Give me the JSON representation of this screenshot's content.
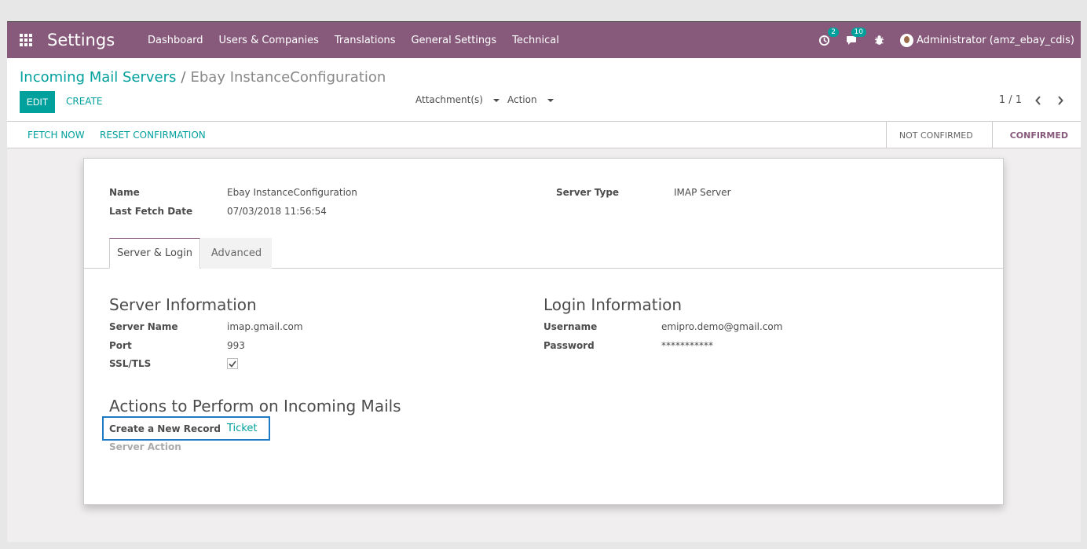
{
  "topbar": {
    "brand": "Settings",
    "menu": [
      "Dashboard",
      "Users & Companies",
      "Translations",
      "General Settings",
      "Technical"
    ],
    "activity_badge": "2",
    "messages_badge": "10",
    "user": "Administrator (amz_ebay_cdis)"
  },
  "control_panel": {
    "breadcrumb_parent": "Incoming Mail Servers",
    "breadcrumb_sep": "/",
    "breadcrumb_current": "Ebay InstanceConfiguration",
    "edit": "EDIT",
    "create": "CREATE",
    "attachments": "Attachment(s)",
    "action": "Action",
    "pager": "1 / 1"
  },
  "statusbar": {
    "fetch_now": "FETCH NOW",
    "reset_confirmation": "RESET CONFIRMATION",
    "states": [
      "NOT CONFIRMED",
      "CONFIRMED"
    ],
    "current_state": "CONFIRMED"
  },
  "form": {
    "name_label": "Name",
    "name_value": "Ebay InstanceConfiguration",
    "last_fetch_label": "Last Fetch Date",
    "last_fetch_value": "07/03/2018 11:56:54",
    "server_type_label": "Server Type",
    "server_type_value": "IMAP Server",
    "tabs": [
      "Server & Login",
      "Advanced"
    ],
    "server_info_title": "Server Information",
    "server_name_label": "Server Name",
    "server_name_value": "imap.gmail.com",
    "port_label": "Port",
    "port_value": "993",
    "ssl_label": "SSL/TLS",
    "ssl_checked": true,
    "login_info_title": "Login Information",
    "username_label": "Username",
    "username_value": "emipro.demo@gmail.com",
    "password_label": "Password",
    "password_value": "***********",
    "actions_title": "Actions to Perform on Incoming Mails",
    "create_record_label": "Create a New Record",
    "create_record_value": "Ticket",
    "server_action_label": "Server Action"
  },
  "colors": {
    "brand": "#875a7b",
    "accent": "#00a09d",
    "highlight": "#1e7ac4"
  }
}
